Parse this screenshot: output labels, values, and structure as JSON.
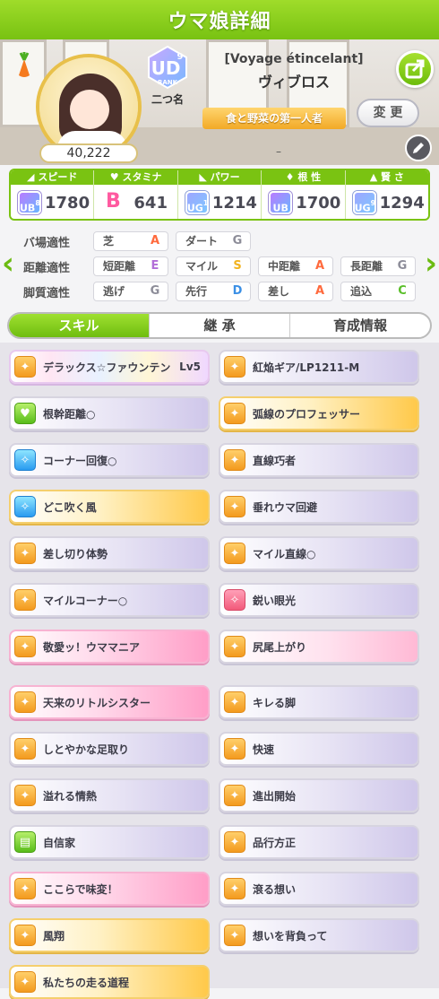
{
  "header": {
    "title": "ウマ娘詳細"
  },
  "profile": {
    "fans": "40,222",
    "rank_letters": "UD",
    "rank_number": "9",
    "rank_word": "RANK",
    "rank_name": "二つ名",
    "epithet": "[Voyage étincelant]",
    "name": "ヴィブロス",
    "title": "食と野菜の第一人者",
    "change_label": "変 更",
    "dash": "–"
  },
  "stats": [
    {
      "label": "スピード",
      "icon": "shoe-icon",
      "grade": "UB",
      "grade_num": "8",
      "value": "1780"
    },
    {
      "label": "スタミナ",
      "icon": "heart-icon",
      "grade": "B",
      "grade_num": "",
      "value": "641"
    },
    {
      "label": "パワー",
      "icon": "muscle-icon",
      "grade": "UG",
      "grade_num": "1",
      "value": "1214"
    },
    {
      "label": "根 性",
      "icon": "flame-icon",
      "grade": "UB",
      "grade_num": "",
      "value": "1700"
    },
    {
      "label": "賢 さ",
      "icon": "cap-icon",
      "grade": "UG",
      "grade_num": "9",
      "value": "1294"
    }
  ],
  "aptitude": {
    "rows": [
      {
        "label": "バ場適性",
        "cells": [
          {
            "name": "芝",
            "grade": "A"
          },
          {
            "name": "ダート",
            "grade": "G"
          }
        ]
      },
      {
        "label": "距離適性",
        "cells": [
          {
            "name": "短距離",
            "grade": "E"
          },
          {
            "name": "マイル",
            "grade": "S"
          },
          {
            "name": "中距離",
            "grade": "A"
          },
          {
            "name": "長距離",
            "grade": "G"
          }
        ]
      },
      {
        "label": "脚質適性",
        "cells": [
          {
            "name": "逃げ",
            "grade": "G"
          },
          {
            "name": "先行",
            "grade": "D"
          },
          {
            "name": "差し",
            "grade": "A"
          },
          {
            "name": "追込",
            "grade": "C"
          }
        ]
      }
    ]
  },
  "tabs": [
    {
      "label": "スキル"
    },
    {
      "label": "継 承"
    },
    {
      "label": "育成情報"
    }
  ],
  "skills": [
    {
      "name": "デラックス☆ファウンテン",
      "level": "Lv5"
    },
    {
      "name": "紅焔ギア/LP1211-M",
      "level": ""
    },
    {
      "name": "根幹距離○",
      "level": ""
    },
    {
      "name": "弧線のプロフェッサー",
      "level": ""
    },
    {
      "name": "コーナー回復○",
      "level": ""
    },
    {
      "name": "直線巧者",
      "level": ""
    },
    {
      "name": "どこ吹く風",
      "level": ""
    },
    {
      "name": "垂れウマ回避",
      "level": ""
    },
    {
      "name": "差し切り体勢",
      "level": ""
    },
    {
      "name": "マイル直線○",
      "level": ""
    },
    {
      "name": "マイルコーナー○",
      "level": ""
    },
    {
      "name": "鋭い眼光",
      "level": ""
    },
    {
      "name": "敬愛ッ！ウママニア",
      "level": ""
    },
    {
      "name": "尻尾上がり",
      "level": ""
    },
    {
      "name": "天来のリトルシスター",
      "level": ""
    },
    {
      "name": "キレる脚",
      "level": ""
    },
    {
      "name": "しとやかな足取り",
      "level": ""
    },
    {
      "name": "快速",
      "level": ""
    },
    {
      "name": "溢れる情熱",
      "level": ""
    },
    {
      "name": "進出開始",
      "level": ""
    },
    {
      "name": "自信家",
      "level": ""
    },
    {
      "name": "品行方正",
      "level": ""
    },
    {
      "name": "ここらで味変！",
      "level": ""
    },
    {
      "name": "滾る想い",
      "level": ""
    },
    {
      "name": "風翔",
      "level": ""
    },
    {
      "name": "想いを背負って",
      "level": ""
    },
    {
      "name": "私たちの走る道程",
      "level": ""
    }
  ]
}
